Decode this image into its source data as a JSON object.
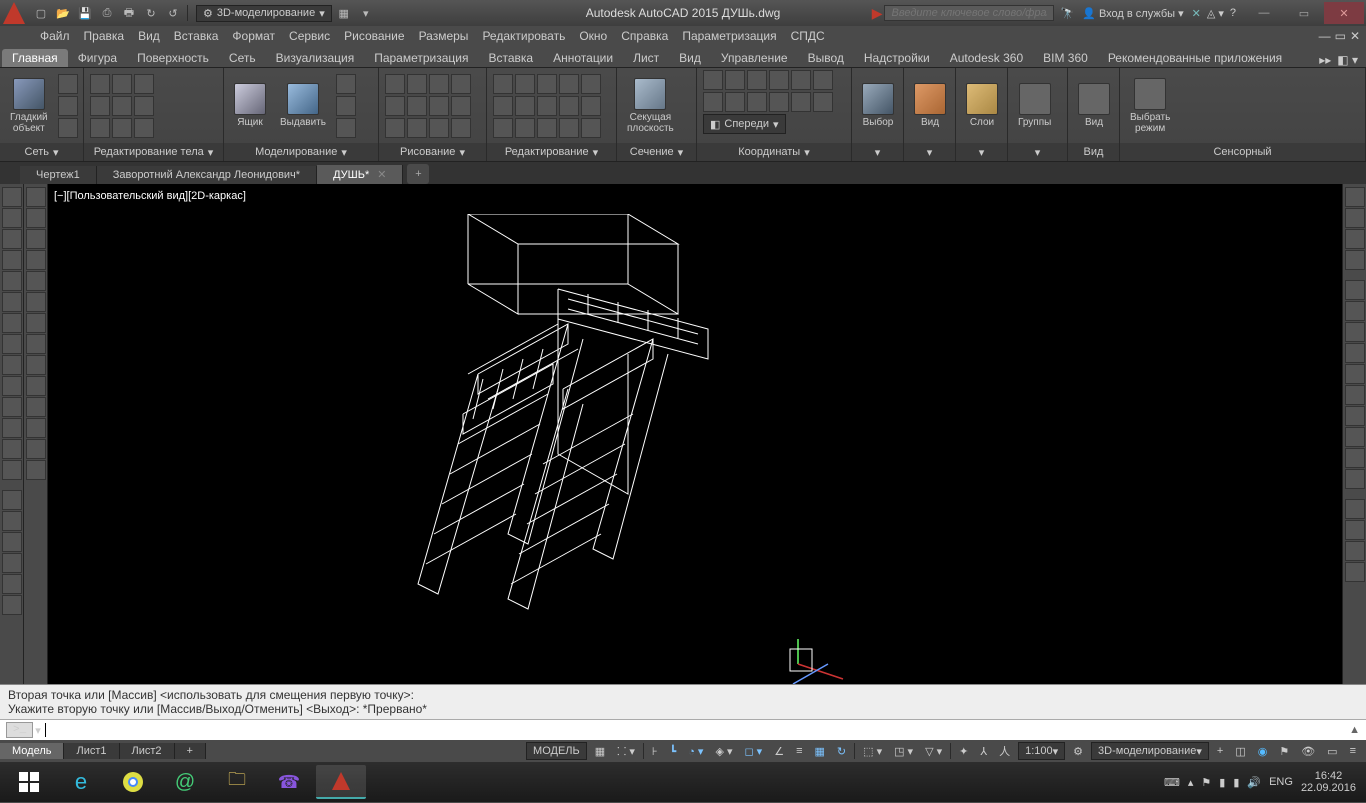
{
  "title": "Autodesk AutoCAD 2015    ДУШь.dwg",
  "qat_workspace": "3D-моделирование",
  "search_placeholder": "Введите ключевое слово/фразу",
  "signin": "Вход в службы",
  "menu": [
    "Файл",
    "Правка",
    "Вид",
    "Вставка",
    "Формат",
    "Сервис",
    "Рисование",
    "Размеры",
    "Редактировать",
    "Окно",
    "Справка",
    "Параметризация",
    "СПДС"
  ],
  "ribbon_tabs": [
    "Главная",
    "Фигура",
    "Поверхность",
    "Сеть",
    "Визуализация",
    "Параметризация",
    "Вставка",
    "Аннотации",
    "Лист",
    "Вид",
    "Управление",
    "Вывод",
    "Надстройки",
    "Autodesk 360",
    "BIM 360",
    "Рекомендованные приложения"
  ],
  "active_ribbon_tab": 0,
  "panels": {
    "p1": {
      "title": "Сеть",
      "btn1": "Гладкий\nобъект"
    },
    "p2": {
      "title": "Редактирование тела"
    },
    "p3": {
      "title": "Моделирование",
      "btn1": "Ящик",
      "btn2": "Выдавить"
    },
    "p4": {
      "title": "Рисование"
    },
    "p5": {
      "title": "Редактирование"
    },
    "p6": {
      "title": "Сечение",
      "btn1": "Секущая\nплоскость"
    },
    "p7": {
      "title": "Координаты",
      "dd": "Спереди"
    },
    "p8": {
      "btn1": "Выбор"
    },
    "p9": {
      "btn1": "Вид"
    },
    "p10": {
      "btn1": "Слои"
    },
    "p11": {
      "btn1": "Группы"
    },
    "p12": {
      "title": "Вид",
      "btn1": "Вид"
    },
    "p13": {
      "title": "Сенсорный",
      "btn1": "Выбрать\nрежим"
    }
  },
  "file_tabs": [
    {
      "label": "Чертеж1",
      "active": false,
      "dirty": false
    },
    {
      "label": "Заворотний Александр Леонидович*",
      "active": false,
      "dirty": true
    },
    {
      "label": "ДУШЬ*",
      "active": true,
      "dirty": true
    }
  ],
  "view_label": "[−][Пользовательский вид][2D-каркас]",
  "cmd_history": [
    "Вторая точка или [Массив] <использовать для смещения первую точку>:",
    "Укажите вторую точку или [Массив/Выход/Отменить] <Выход>: *Прервано*"
  ],
  "cmd_prompt": ">_",
  "layout_tabs": [
    "Модель",
    "Лист1",
    "Лист2"
  ],
  "active_layout": 0,
  "status": {
    "model": "МОДЕЛЬ",
    "scale": "1:100",
    "ws": "3D-моделирование"
  },
  "tray": {
    "lang": "ENG",
    "time": "16:42",
    "date": "22.09.2016"
  }
}
